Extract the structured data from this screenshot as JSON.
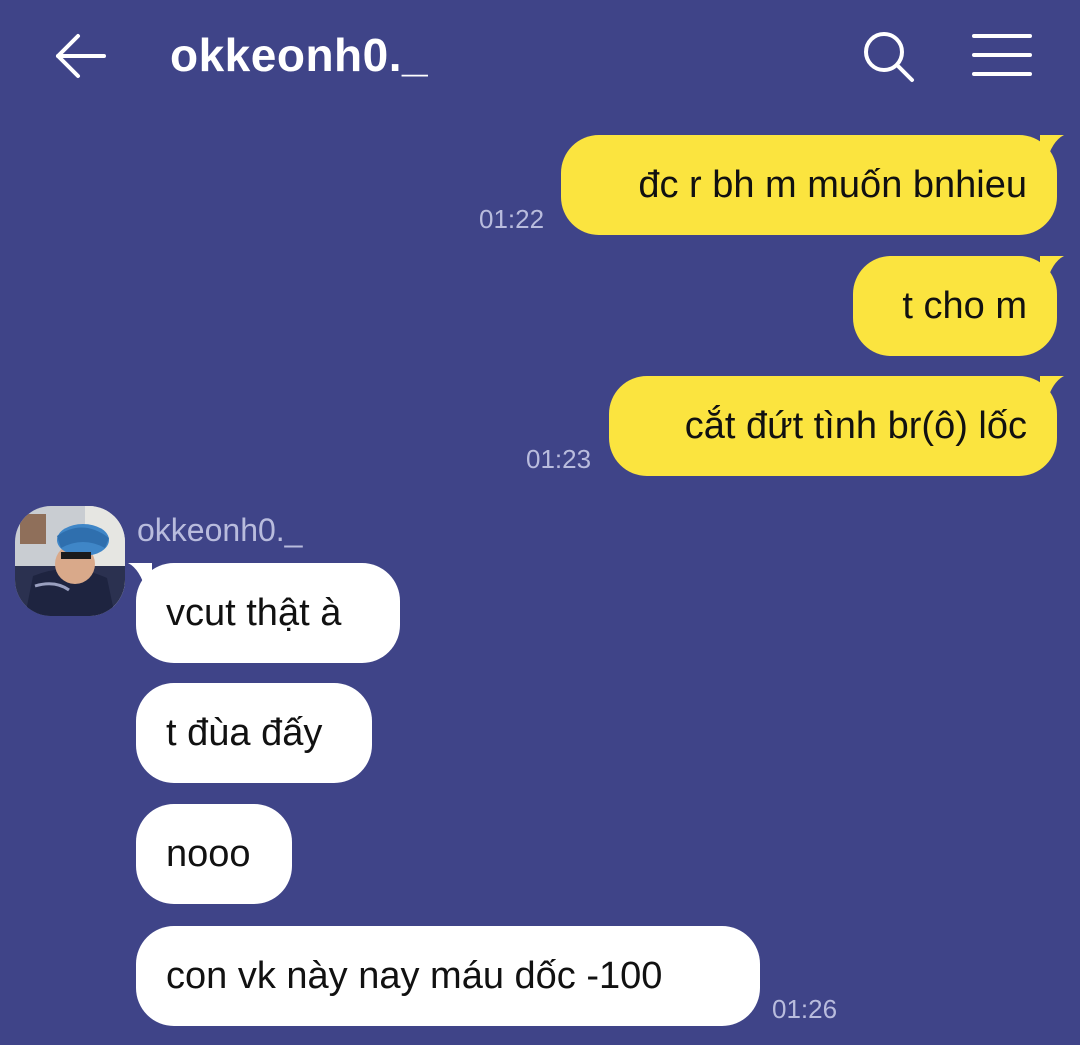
{
  "header": {
    "title": "okkeonh0._",
    "back_icon": "arrow-left-icon",
    "search_icon": "search-icon",
    "menu_icon": "hamburger-menu-icon"
  },
  "colors": {
    "background": "#3f4488",
    "outgoing_bubble": "#fbe43f",
    "incoming_bubble": "#ffffff",
    "timestamp": "#b9bcdd"
  },
  "messages": {
    "outgoing": [
      {
        "text": "đc r bh m muốn bnhieu",
        "time": "01:22"
      },
      {
        "text": "t cho m"
      },
      {
        "text": "cắt đứt tình br(ô) lốc",
        "time": "01:23"
      }
    ],
    "sender_name": "okkeonh0._",
    "incoming": [
      {
        "text": "vcut thật à"
      },
      {
        "text": "t đùa đấy"
      },
      {
        "text": "nooo"
      },
      {
        "text": "con vk này nay máu dốc -100",
        "time": "01:26"
      }
    ]
  }
}
